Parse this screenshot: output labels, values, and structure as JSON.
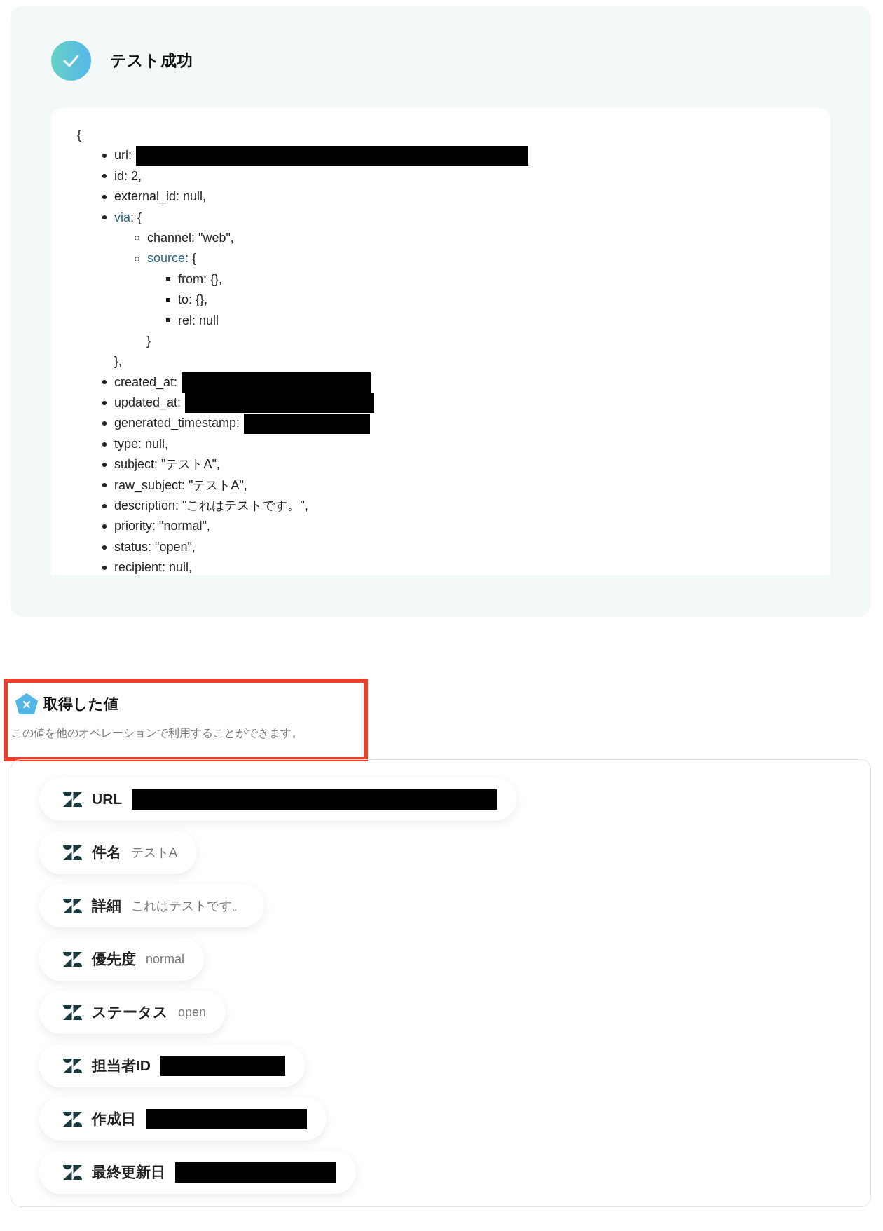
{
  "test_result": {
    "title": "テスト成功",
    "success": true,
    "code": {
      "open": "{",
      "items": [
        {
          "text": "url:",
          "redacted": true
        },
        {
          "text": "id: 2,"
        },
        {
          "text": "external_id: null,"
        },
        {
          "kind": "object",
          "key": "via",
          "rest": ": {",
          "close": "},",
          "children": [
            {
              "text": "channel: \"web\","
            },
            {
              "kind": "object",
              "key": "source",
              "rest": ": {",
              "close": "}",
              "children": [
                {
                  "text": "from: {},"
                },
                {
                  "text": "to: {},"
                },
                {
                  "text": "rel: null"
                }
              ]
            }
          ]
        },
        {
          "text": "created_at:",
          "redacted": true
        },
        {
          "text": "updated_at:",
          "redacted": true
        },
        {
          "text": "generated_timestamp:",
          "redacted": true
        },
        {
          "text": "type: null,"
        },
        {
          "text": "subject: \"テストA\","
        },
        {
          "text": "raw_subject: \"テストA\","
        },
        {
          "text": "description: \"これはテストです。\","
        },
        {
          "text": "priority: \"normal\","
        },
        {
          "text": "status: \"open\","
        },
        {
          "text": "recipient: null,"
        }
      ]
    }
  },
  "output_values": {
    "title": "取得した値",
    "description": "この値を他のオペレーションで利用することができます。",
    "highlighted": true,
    "items": [
      {
        "label": "URL",
        "redacted": true
      },
      {
        "label": "件名",
        "value": "テストA"
      },
      {
        "label": "詳細",
        "value": "これはテストです。"
      },
      {
        "label": "優先度",
        "value": "normal"
      },
      {
        "label": "ステータス",
        "value": "open"
      },
      {
        "label": "担当者ID",
        "redacted": true
      },
      {
        "label": "作成日",
        "redacted": true
      },
      {
        "label": "最終更新日",
        "redacted": true
      }
    ]
  }
}
